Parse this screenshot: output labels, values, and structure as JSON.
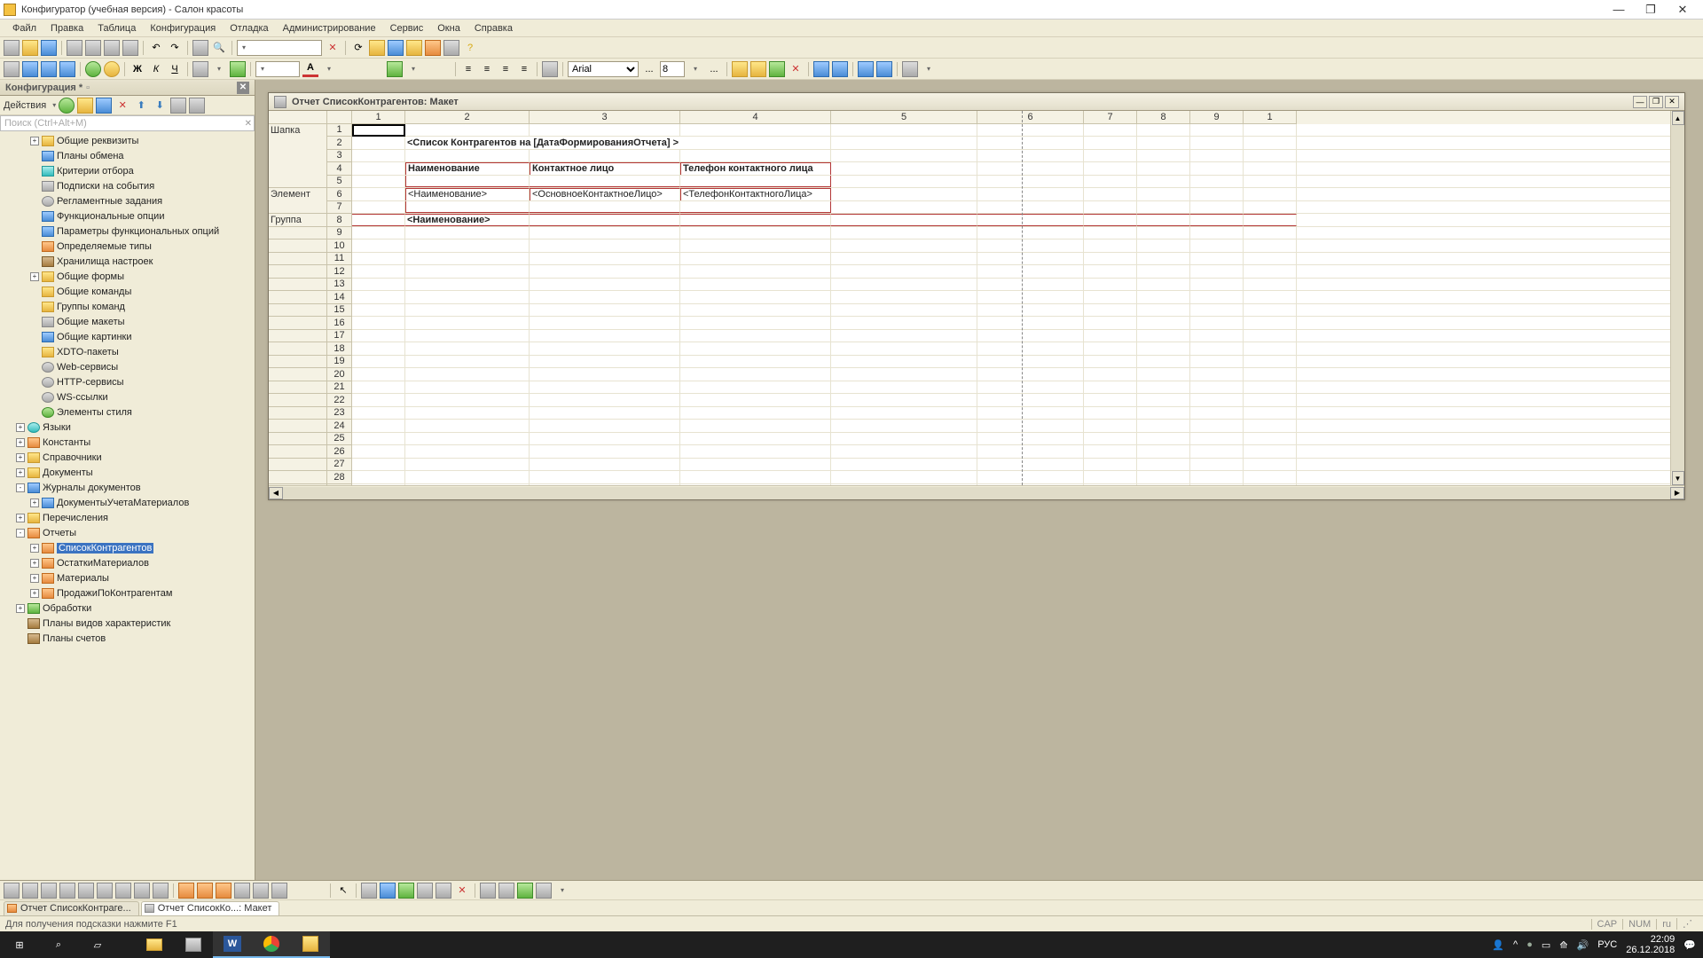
{
  "window": {
    "title": "Конфигуратор (учебная версия) - Салон красоты"
  },
  "menu": {
    "file": "Файл",
    "edit": "Правка",
    "table": "Таблица",
    "config": "Конфигурация",
    "debug": "Отладка",
    "admin": "Администрирование",
    "service": "Сервис",
    "windows": "Окна",
    "help": "Справка"
  },
  "toolbar2": {
    "font": "Arial",
    "size": "8"
  },
  "config_panel": {
    "title": "Конфигурация *",
    "actions_label": "Действия",
    "search_placeholder": "Поиск (Ctrl+Alt+M)"
  },
  "tree": [
    {
      "ind": 1,
      "exp": "+",
      "ic": "ic-yellow",
      "label": "Общие реквизиты"
    },
    {
      "ind": 1,
      "exp": "",
      "ic": "ic-blue",
      "label": "Планы обмена"
    },
    {
      "ind": 1,
      "exp": "",
      "ic": "ic-cyan",
      "label": "Критерии отбора"
    },
    {
      "ind": 1,
      "exp": "",
      "ic": "ic-gray",
      "label": "Подписки на события"
    },
    {
      "ind": 1,
      "exp": "",
      "ic": "ic-gray round",
      "label": "Регламентные задания"
    },
    {
      "ind": 1,
      "exp": "",
      "ic": "ic-blue",
      "label": "Функциональные опции"
    },
    {
      "ind": 1,
      "exp": "",
      "ic": "ic-blue",
      "label": "Параметры функциональных опций"
    },
    {
      "ind": 1,
      "exp": "",
      "ic": "ic-orange",
      "label": "Определяемые типы"
    },
    {
      "ind": 1,
      "exp": "",
      "ic": "ic-brown",
      "label": "Хранилища настроек"
    },
    {
      "ind": 1,
      "exp": "+",
      "ic": "ic-yellow",
      "label": "Общие формы"
    },
    {
      "ind": 1,
      "exp": "",
      "ic": "ic-yellow",
      "label": "Общие команды"
    },
    {
      "ind": 1,
      "exp": "",
      "ic": "ic-yellow",
      "label": "Группы команд"
    },
    {
      "ind": 1,
      "exp": "",
      "ic": "ic-gray",
      "label": "Общие макеты"
    },
    {
      "ind": 1,
      "exp": "",
      "ic": "ic-blue",
      "label": "Общие картинки"
    },
    {
      "ind": 1,
      "exp": "",
      "ic": "ic-yellow",
      "label": "XDTO-пакеты"
    },
    {
      "ind": 1,
      "exp": "",
      "ic": "ic-gray round",
      "label": "Web-сервисы"
    },
    {
      "ind": 1,
      "exp": "",
      "ic": "ic-gray round",
      "label": "HTTP-сервисы"
    },
    {
      "ind": 1,
      "exp": "",
      "ic": "ic-gray round",
      "label": "WS-ссылки"
    },
    {
      "ind": 1,
      "exp": "",
      "ic": "ic-green round",
      "label": "Элементы стиля"
    },
    {
      "ind": 0,
      "exp": "+",
      "ic": "ic-cyan round",
      "label": "Языки"
    },
    {
      "ind": 0,
      "exp": "+",
      "ic": "ic-orange",
      "label": "Константы"
    },
    {
      "ind": 0,
      "exp": "+",
      "ic": "ic-yellow",
      "label": "Справочники"
    },
    {
      "ind": 0,
      "exp": "+",
      "ic": "ic-yellow",
      "label": "Документы"
    },
    {
      "ind": 0,
      "exp": "-",
      "ic": "ic-blue",
      "label": "Журналы документов"
    },
    {
      "ind": 1,
      "exp": "+",
      "ic": "ic-blue",
      "label": "ДокументыУчетаМатериалов"
    },
    {
      "ind": 0,
      "exp": "+",
      "ic": "ic-yellow",
      "label": "Перечисления"
    },
    {
      "ind": 0,
      "exp": "-",
      "ic": "ic-orange",
      "label": "Отчеты"
    },
    {
      "ind": 1,
      "exp": "+",
      "ic": "ic-orange",
      "label": "СписокКонтрагентов",
      "sel": true
    },
    {
      "ind": 1,
      "exp": "+",
      "ic": "ic-orange",
      "label": "ОстаткиМатериалов"
    },
    {
      "ind": 1,
      "exp": "+",
      "ic": "ic-orange",
      "label": "Материалы"
    },
    {
      "ind": 1,
      "exp": "+",
      "ic": "ic-orange",
      "label": "ПродажиПоКонтрагентам"
    },
    {
      "ind": 0,
      "exp": "+",
      "ic": "ic-green",
      "label": "Обработки"
    },
    {
      "ind": 0,
      "exp": "",
      "ic": "ic-brown",
      "label": "Планы видов характеристик"
    },
    {
      "ind": 0,
      "exp": "",
      "ic": "ic-brown",
      "label": "Планы счетов"
    }
  ],
  "doc": {
    "title": "Отчет СписокКонтрагентов: Макет",
    "groups": {
      "r1": "Шапка",
      "r6": "Элемент",
      "r8": "Группа"
    },
    "cols": [
      60,
      140,
      170,
      170,
      165,
      120,
      60,
      60,
      60,
      60,
      60,
      60
    ],
    "col_headers": [
      "1",
      "2",
      "3",
      "4",
      "5",
      "6",
      "7",
      "8",
      "9",
      "1"
    ],
    "title_text": "<Список Контрагентов на [ДатаФормированияОтчета] >",
    "hdr_name": "Наименование",
    "hdr_contact": "Контактное лицо",
    "hdr_phone": "Телефон контактного лица",
    "el_name": "<Наименование>",
    "el_contact": "<ОсновноеКонтактноеЛицо>",
    "el_phone": "<ТелефонКонтактногоЛица>",
    "grp_name": "<Наименование>",
    "row_count": 29
  },
  "tabs": {
    "t1": "Отчет СписокКонтраге...",
    "t2": "Отчет СписокКо...: Макет"
  },
  "status": {
    "hint": "Для получения подсказки нажмите F1",
    "cap": "CAP",
    "num": "NUM",
    "lang": "ru"
  },
  "taskbar": {
    "lang2": "РУС",
    "time": "22:09",
    "date": "26.12.2018"
  }
}
